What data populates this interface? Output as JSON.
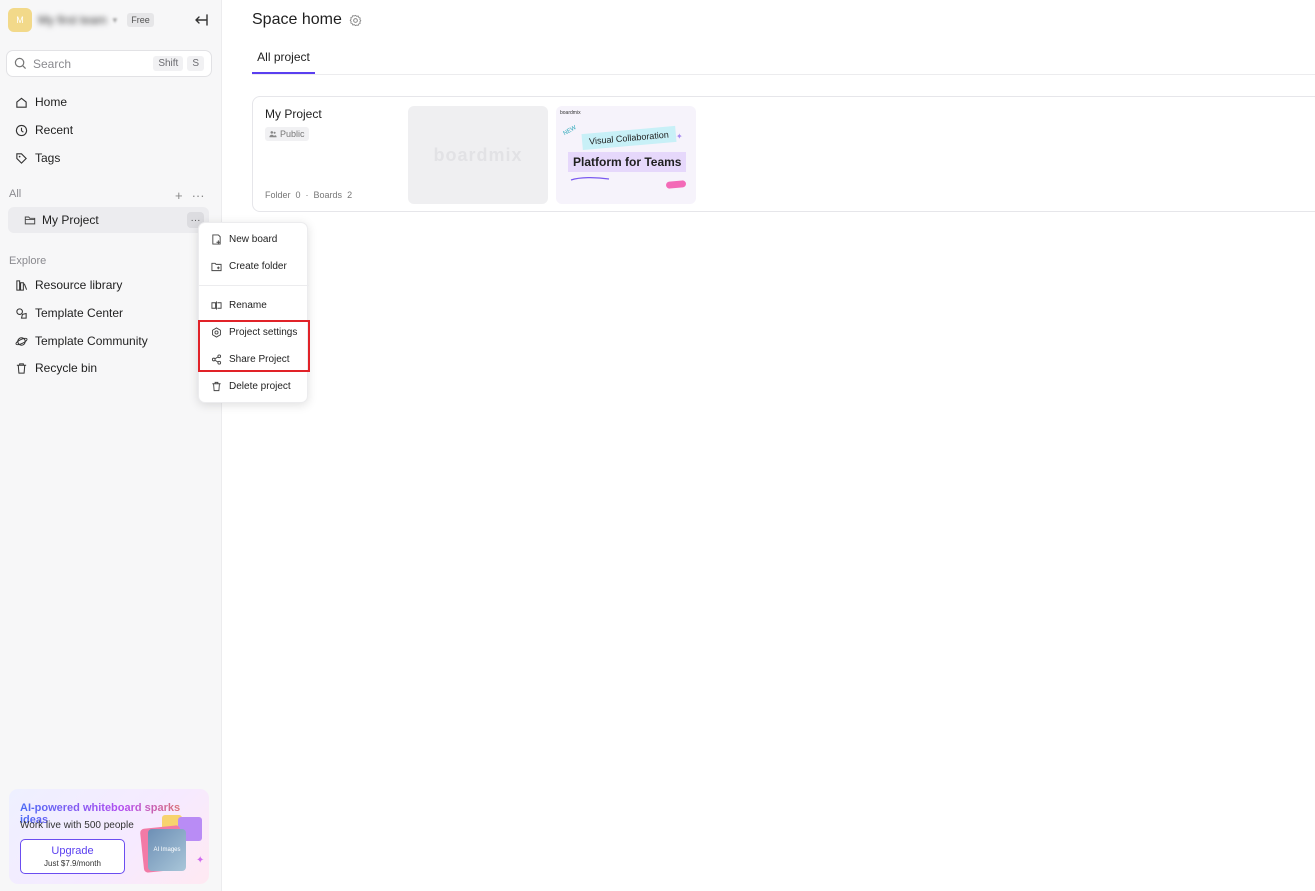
{
  "sidebar": {
    "team_name": "My first team",
    "plan": "Free",
    "search": {
      "placeholder": "Search",
      "shortcut_1": "Shift",
      "shortcut_2": "S"
    },
    "nav": [
      {
        "label": "Home",
        "icon": "home-icon"
      },
      {
        "label": "Recent",
        "icon": "clock-icon"
      },
      {
        "label": "Tags",
        "icon": "tag-icon"
      }
    ],
    "all_label": "All",
    "project_name": "My Project",
    "explore_label": "Explore",
    "explore": [
      {
        "label": "Resource library",
        "icon": "library-icon"
      },
      {
        "label": "Template Center",
        "icon": "template-icon"
      },
      {
        "label": "Template Community",
        "icon": "planet-icon"
      },
      {
        "label": "Recycle bin",
        "icon": "trash-icon"
      }
    ],
    "promo": {
      "title": "AI-powered whiteboard sparks ideas",
      "subtitle": "Work live with 500 people",
      "button": "Upgrade",
      "price": "Just $7.9/month",
      "art_label": "AI Images"
    }
  },
  "main": {
    "title": "Space home",
    "tab": "All project",
    "card": {
      "title": "My Project",
      "visibility": "Public",
      "folder_label": "Folder",
      "folder_count": "0",
      "boards_label": "Boards",
      "boards_count": "2",
      "thumb1_text": "boardmix",
      "thumb2_brand": "boardmix",
      "thumb2_new": "NEW",
      "thumb2_line1": "Visual Collaboration",
      "thumb2_line2": "Platform for Teams"
    }
  },
  "context_menu": {
    "items": [
      {
        "label": "New board",
        "icon": "new-board-icon"
      },
      {
        "label": "Create folder",
        "icon": "create-folder-icon"
      },
      {
        "label": "Rename",
        "icon": "rename-icon"
      },
      {
        "label": "Project settings",
        "icon": "settings-icon"
      },
      {
        "label": "Share Project",
        "icon": "share-icon"
      },
      {
        "label": "Delete project",
        "icon": "trash-icon"
      }
    ]
  },
  "colors": {
    "accent": "#5a3ff0",
    "highlight": "#e12228"
  }
}
